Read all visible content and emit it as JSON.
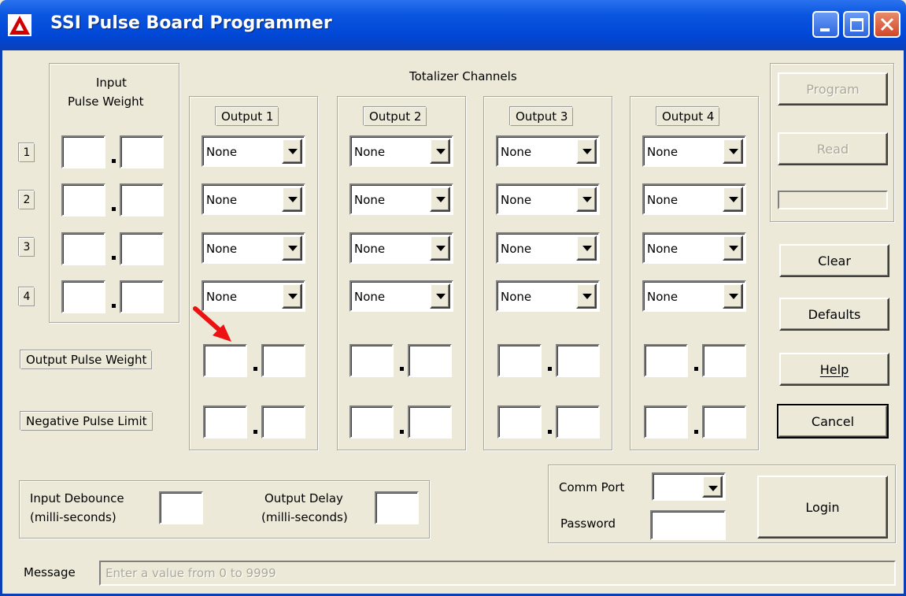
{
  "window": {
    "title": "SSI Pulse Board Programmer"
  },
  "input_group": {
    "title_line1": "Input",
    "title_line2": "Pulse Weight",
    "row_numbers": [
      "1",
      "2",
      "3",
      "4"
    ]
  },
  "totalizer": {
    "title": "Totalizer Channels",
    "outputs": [
      {
        "label": "Output 1",
        "selects": [
          "None",
          "None",
          "None",
          "None"
        ]
      },
      {
        "label": "Output 2",
        "selects": [
          "None",
          "None",
          "None",
          "None"
        ]
      },
      {
        "label": "Output 3",
        "selects": [
          "None",
          "None",
          "None",
          "None"
        ]
      },
      {
        "label": "Output 4",
        "selects": [
          "None",
          "None",
          "None",
          "None"
        ]
      }
    ],
    "output_pulse_weight_label": "Output Pulse Weight",
    "negative_pulse_limit_label": "Negative Pulse Limit"
  },
  "buttons": {
    "program": "Program",
    "read": "Read",
    "clear": "Clear",
    "defaults": "Defaults",
    "help": "Help",
    "cancel": "Cancel",
    "login": "Login"
  },
  "timing": {
    "input_debounce_line1": "Input Debounce",
    "input_debounce_line2": "(milli-seconds)",
    "output_delay_line1": "Output Delay",
    "output_delay_line2": "(milli-seconds)"
  },
  "login": {
    "comm_port_label": "Comm Port",
    "password_label": "Password"
  },
  "message": {
    "label": "Message",
    "placeholder": "Enter a value from 0 to 9999"
  },
  "colors": {
    "titlebar": "#0047d6",
    "window_bg": "#ece9d8",
    "annotation_arrow": "#ee1111"
  }
}
